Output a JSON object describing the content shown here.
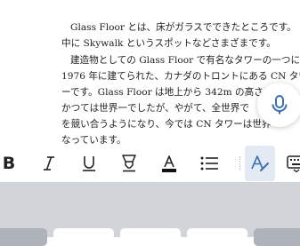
{
  "document": {
    "lines": [
      "Glass Floor とは、床がガラスでできたところです。",
      "中に Skywalk というスポットなどさまざまです。",
      "建造物としての Glass Floor で有名なタワーの一つに、",
      "1976 年に建てられた、カナダのトロントにある CN タワ",
      "ーです。Glass Floor は地上から 342m の高さに",
      "かつては世界一でしたが、やがて、全世界で",
      "を競い合うようになり、今では CN タワーは世界",
      "なっています。"
    ]
  },
  "toolbar": {
    "buttons": [
      {
        "name": "bold-button",
        "icon": "bold-icon",
        "label": "B"
      },
      {
        "name": "italic-button",
        "icon": "italic-icon",
        "label": "I"
      },
      {
        "name": "underline-button",
        "icon": "underline-icon",
        "label": "U"
      },
      {
        "name": "highlight-button",
        "icon": "highlighter-icon"
      },
      {
        "name": "text-color-button",
        "icon": "text-color-icon",
        "label": "A"
      },
      {
        "name": "bulleted-list-button",
        "icon": "bulleted-list-icon"
      },
      {
        "name": "format-button",
        "icon": "text-format-icon",
        "label": "A",
        "active": true
      },
      {
        "name": "keyboard-button",
        "icon": "keyboard-icon"
      }
    ]
  },
  "dictation": {
    "icon": "microphone-icon"
  },
  "colors": {
    "accent": "#3a6fb0",
    "active_bg": "#e3eaf3",
    "keyboard_bg": "#d1d4d9",
    "text": "#222222"
  }
}
